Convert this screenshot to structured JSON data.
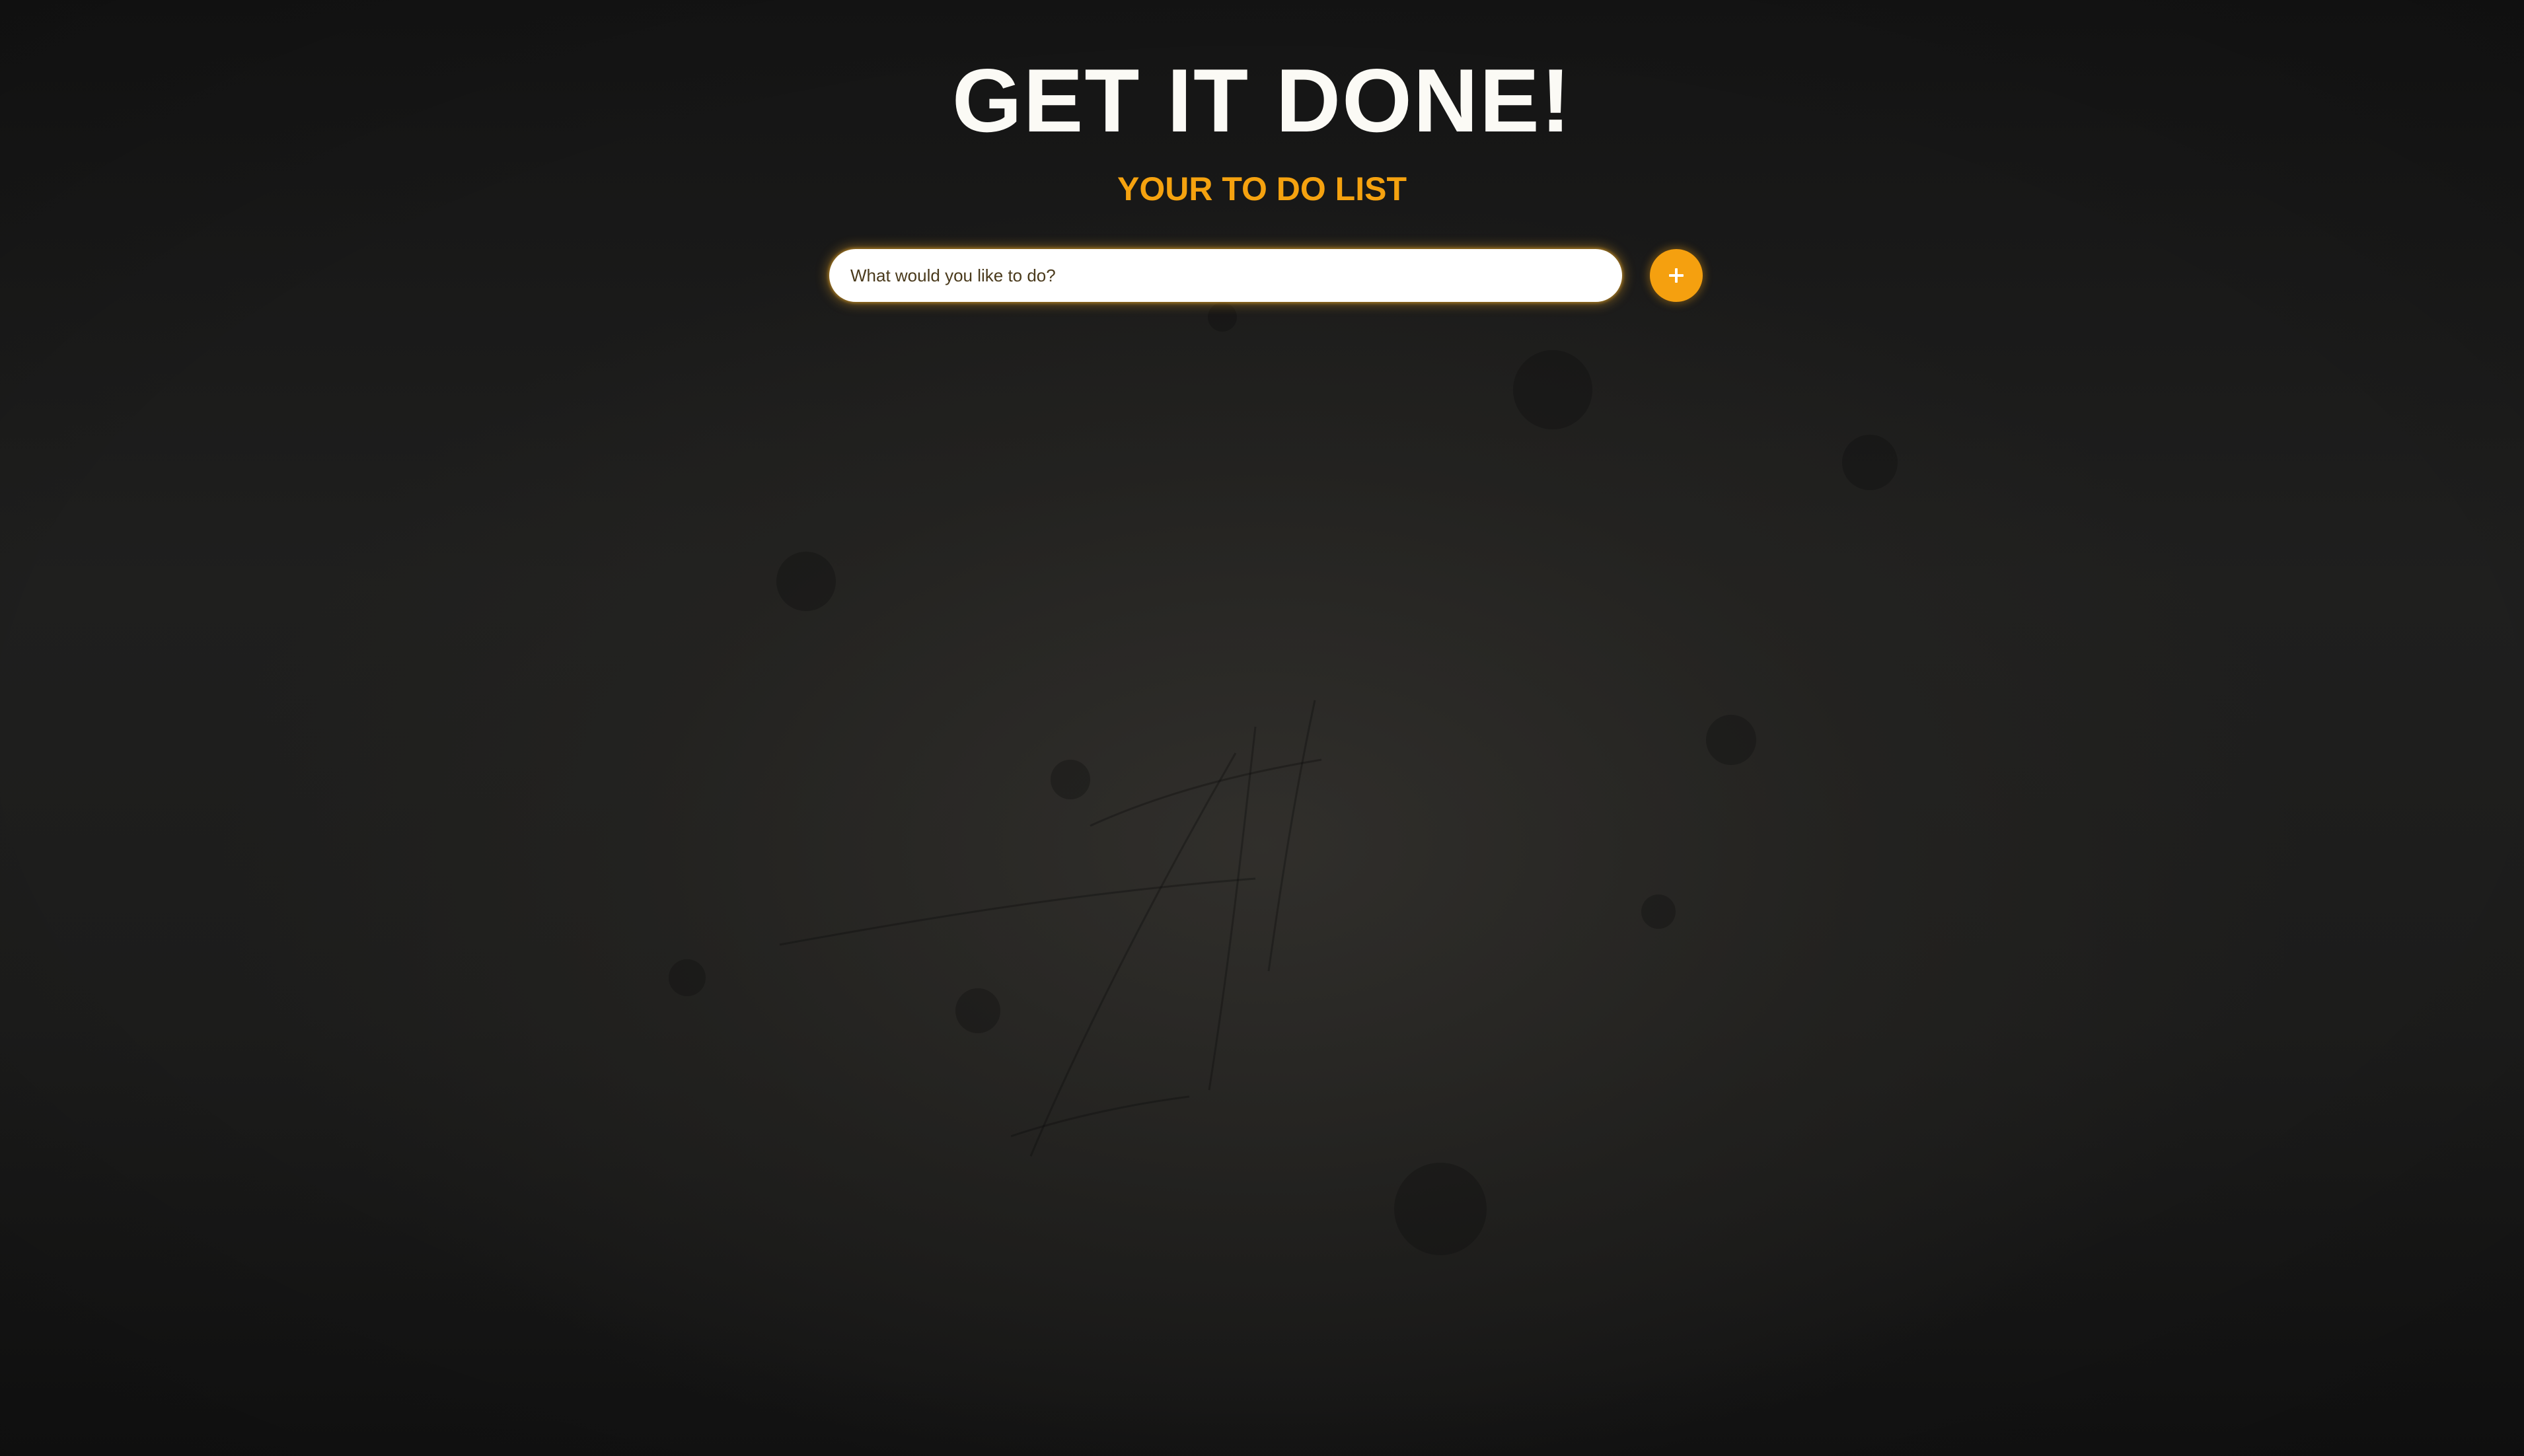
{
  "header": {
    "title": "GET IT DONE!",
    "subtitle": "YOUR TO DO LIST"
  },
  "todo_form": {
    "input_placeholder": "What would you like to do?",
    "input_value": "",
    "add_button_icon": "plus-icon"
  },
  "colors": {
    "background": "#1c1c1b",
    "title": "#fbfaf5",
    "accent": "#f5a00f",
    "input_background": "#ffffff"
  }
}
